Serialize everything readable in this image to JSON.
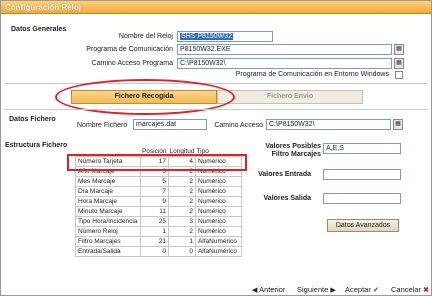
{
  "window": {
    "title": "Configuración Reloj"
  },
  "datos_generales": {
    "section_label": "Datos Generales",
    "nombre_reloj_label": "Nombre del Reloj",
    "nombre_reloj_value": "SHS P8150W32",
    "programa_label": "Programa de Comunicación",
    "programa_value": "P8150W32.EXE",
    "camino_label": "Camino Acceso Programa",
    "camino_value": "C:\\P8150W32\\",
    "entorno_windows_label": "Programa de Comunicación en Entorno Windows"
  },
  "tabs": [
    {
      "label": "Fichero Recogida",
      "active": true
    },
    {
      "label": "Fichero Envio",
      "active": false
    }
  ],
  "datos_fichero": {
    "section_label": "Datos Fichero",
    "nombre_fichero_label": "Nombre Fichero",
    "nombre_fichero_value": "marcajes.dat",
    "camino_acceso_label": "Camino Acceso",
    "camino_acceso_value": "C:\\P8150W32\\"
  },
  "estructura": {
    "section_label": "Estructura Fichero",
    "headers": [
      "",
      "Posición",
      "Longitud",
      "Tipo"
    ],
    "rows": [
      [
        "Número Tarjeta",
        "17",
        "4",
        "Numérico"
      ],
      [
        "Año Marcaje",
        "3",
        "2",
        "Numérico"
      ],
      [
        "Mes Marcaje",
        "5",
        "2",
        "Numérico"
      ],
      [
        "Día Marcaje",
        "7",
        "2",
        "Numérico"
      ],
      [
        "Hora Marcaje",
        "9",
        "2",
        "Numérico"
      ],
      [
        "Minuto Marcaje",
        "11",
        "2",
        "Numérico"
      ],
      [
        "Tipo Hora/Incidencia",
        "25",
        "3",
        "Numérico"
      ],
      [
        "Número Reloj",
        "1",
        "2",
        "Numérico"
      ],
      [
        "Filtro Marcajes",
        "21",
        "1",
        "AlfaNumérico"
      ],
      [
        "Entrada/Salida",
        "0",
        "0",
        "AlfaNumérico"
      ]
    ]
  },
  "valores": {
    "posibles_label_line1": "Valores Posibles",
    "posibles_label_line2": "Filtro Marcajes",
    "posibles_value": "A,E,S",
    "entrada_label": "Valores Entrada",
    "entrada_value": "",
    "salida_label": "Valores Salida",
    "salida_value": ""
  },
  "buttons": {
    "datos_avanzados": "Datos Avanzados",
    "anterior": "Anterior",
    "siguiente": "Siguiente",
    "aceptar": "Aceptar",
    "cancelar": "Cancelar"
  },
  "colors": {
    "title_bar": "#f3a93a",
    "annotation": "#e0212a",
    "selection": "#316ac5"
  }
}
